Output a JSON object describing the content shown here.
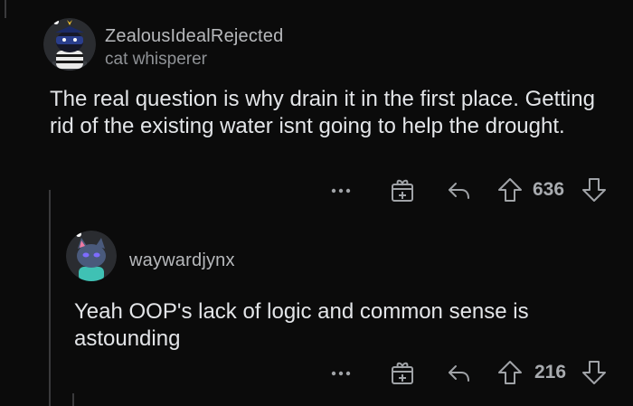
{
  "comments": [
    {
      "username": "ZealousIdealRejected",
      "flair": "cat whisperer",
      "body": "The real question is why drain it in the first place. Getting rid of the existing water isnt going to help the drought.",
      "score": "636"
    },
    {
      "username": "waywardjynx",
      "body": "Yeah OOP's lack of logic and common sense is astounding",
      "score": "216"
    }
  ],
  "icons": {
    "more": "more-options-icon",
    "award": "award-gift-icon",
    "reply": "reply-arrow-icon",
    "upvote": "upvote-arrow-icon",
    "downvote": "downvote-arrow-icon"
  }
}
